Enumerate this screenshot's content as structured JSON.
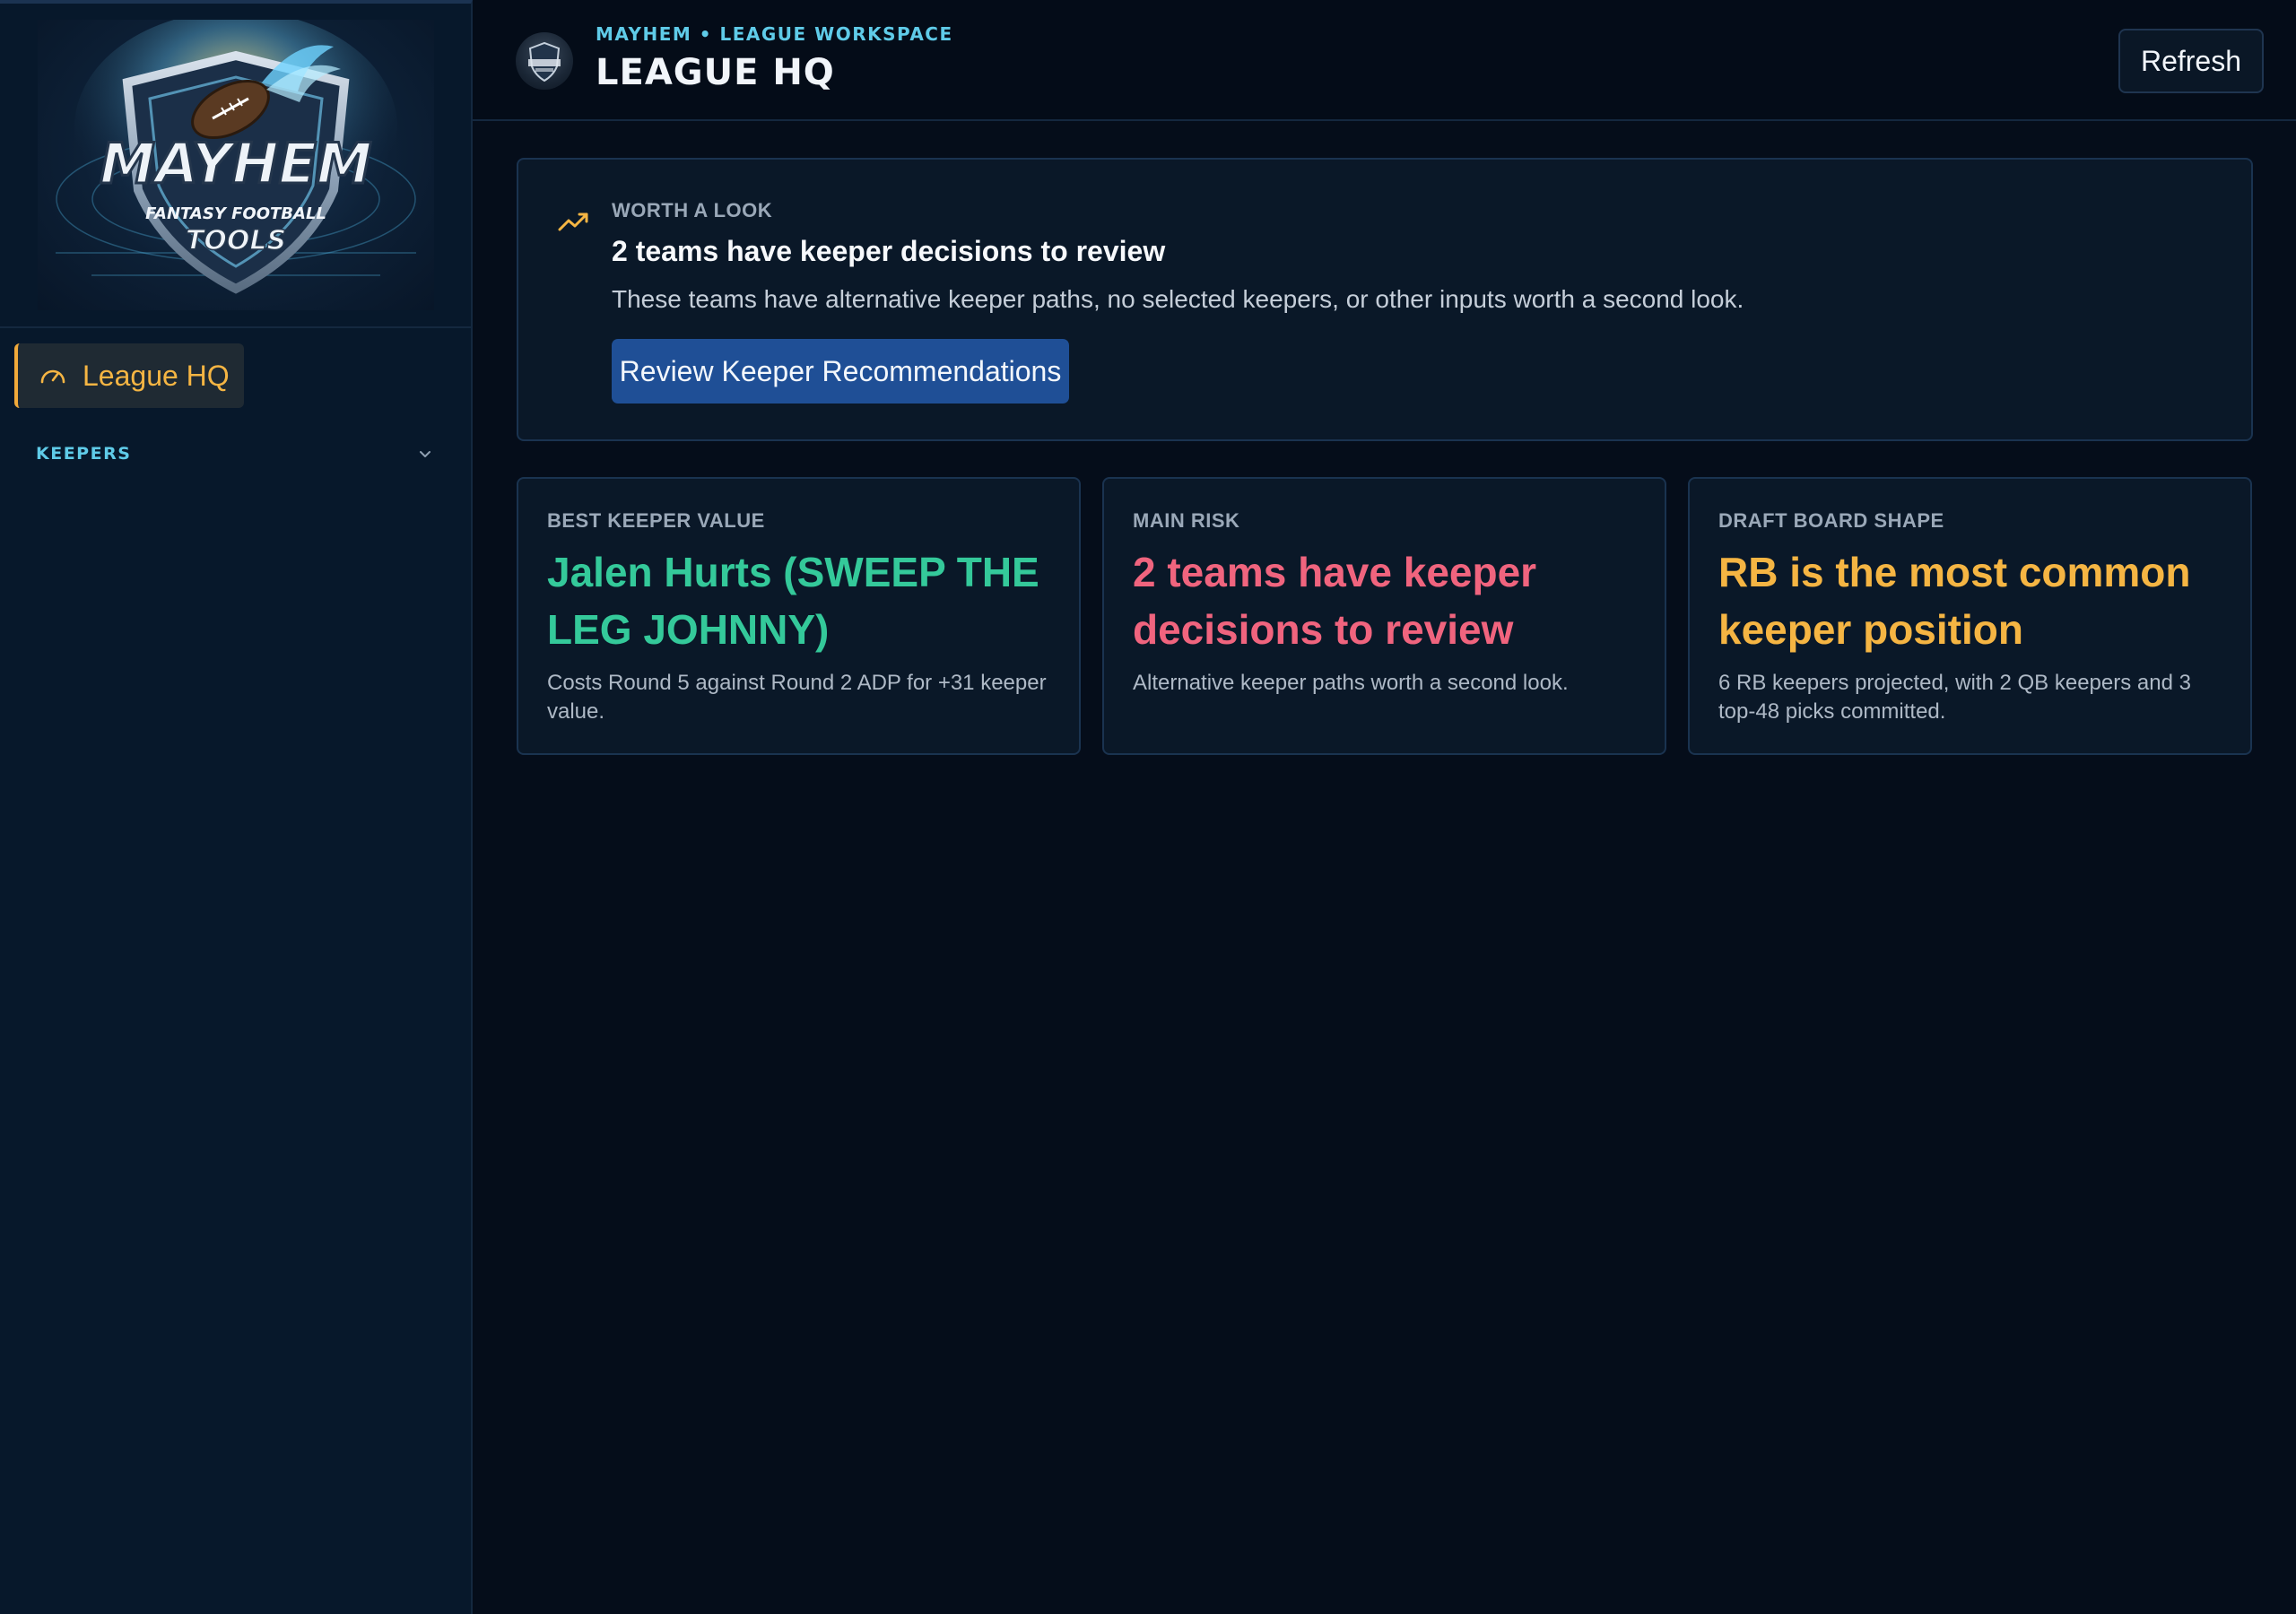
{
  "sidebar": {
    "logo_alt": "Mayhem Fantasy Football Tools logo",
    "logo_text": {
      "main": "MAYHEM",
      "sub": "FANTASY FOOTBALL",
      "tag": "TOOLS"
    },
    "nav_active": {
      "label": "League HQ",
      "icon": "gauge-icon",
      "color": "#f5b543"
    },
    "section": {
      "label": "KEEPERS",
      "expanded": false
    }
  },
  "header": {
    "kicker": "MAYHEM • LEAGUE WORKSPACE",
    "title": "LEAGUE HQ",
    "refresh_label": "Refresh"
  },
  "alert": {
    "icon": "trending-up-icon",
    "kicker": "WORTH A LOOK",
    "title": "2 teams have keeper decisions to review",
    "description": "These teams have alternative keeper paths, no selected keepers, or other inputs worth a second look.",
    "button_label": "Review Keeper Recommendations"
  },
  "metrics": [
    {
      "kicker": "BEST KEEPER VALUE",
      "headline": "Jalen Hurts (SWEEP THE LEG JOHNNY)",
      "sub": "Costs Round 5 against Round 2 ADP for +31 keeper value.",
      "color": "#34c99a"
    },
    {
      "kicker": "MAIN RISK",
      "headline": "2 teams have keeper decisions to review",
      "sub": "Alternative keeper paths worth a second look.",
      "color": "#f0647e"
    },
    {
      "kicker": "DRAFT BOARD SHAPE",
      "headline": "RB is the most common keeper position",
      "sub": "6 RB keepers projected, with 2 QB keepers and 3 top-48 picks committed.",
      "color": "#f5b543"
    }
  ],
  "colors": {
    "background": "#050d1a",
    "sidebar": "#07182b",
    "accent_cyan": "#5fcbe8",
    "accent_orange": "#f5b543",
    "primary_button": "#1f4f96"
  }
}
